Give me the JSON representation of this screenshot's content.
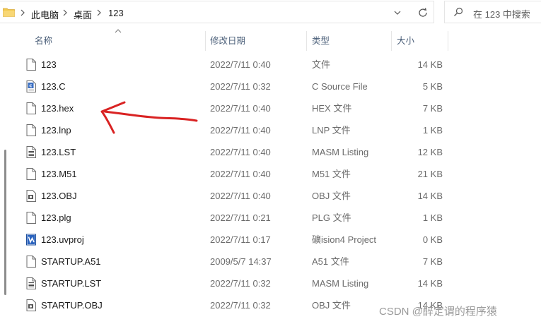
{
  "address": {
    "crumbs": [
      "此电脑",
      "桌面",
      "123"
    ]
  },
  "search": {
    "placeholder": "在 123 中搜索"
  },
  "columns": {
    "name": "名称",
    "date": "修改日期",
    "type": "类型",
    "size": "大小"
  },
  "files": [
    {
      "name": "123",
      "date": "2022/7/11 0:40",
      "type": "文件",
      "size": "14 KB",
      "icon": "blank-file-icon"
    },
    {
      "name": "123.C",
      "date": "2022/7/11 0:32",
      "type": "C Source File",
      "size": "5 KB",
      "icon": "c-source-file-icon"
    },
    {
      "name": "123.hex",
      "date": "2022/7/11 0:40",
      "type": "HEX 文件",
      "size": "7 KB",
      "icon": "blank-file-icon"
    },
    {
      "name": "123.lnp",
      "date": "2022/7/11 0:40",
      "type": "LNP 文件",
      "size": "1 KB",
      "icon": "blank-file-icon"
    },
    {
      "name": "123.LST",
      "date": "2022/7/11 0:40",
      "type": "MASM Listing",
      "size": "12 KB",
      "icon": "text-file-icon"
    },
    {
      "name": "123.M51",
      "date": "2022/7/11 0:40",
      "type": "M51 文件",
      "size": "21 KB",
      "icon": "blank-file-icon"
    },
    {
      "name": "123.OBJ",
      "date": "2022/7/11 0:40",
      "type": "OBJ 文件",
      "size": "14 KB",
      "icon": "obj-file-icon"
    },
    {
      "name": "123.plg",
      "date": "2022/7/11 0:21",
      "type": "PLG 文件",
      "size": "1 KB",
      "icon": "blank-file-icon"
    },
    {
      "name": "123.uvproj",
      "date": "2022/7/11 0:17",
      "type": "礦ision4 Project",
      "size": "0 KB",
      "icon": "uvision-project-icon"
    },
    {
      "name": "STARTUP.A51",
      "date": "2009/5/7 14:37",
      "type": "A51 文件",
      "size": "7 KB",
      "icon": "blank-file-icon"
    },
    {
      "name": "STARTUP.LST",
      "date": "2022/7/11 0:32",
      "type": "MASM Listing",
      "size": "14 KB",
      "icon": "text-file-icon"
    },
    {
      "name": "STARTUP.OBJ",
      "date": "2022/7/11 0:32",
      "type": "OBJ 文件",
      "size": "14 KB",
      "icon": "obj-file-icon"
    }
  ],
  "watermark": "CSDN @醉定谓的程序猿",
  "colors": {
    "annotation": "#d92222",
    "header_text": "#4c607a",
    "folder": "#f2c94c"
  }
}
